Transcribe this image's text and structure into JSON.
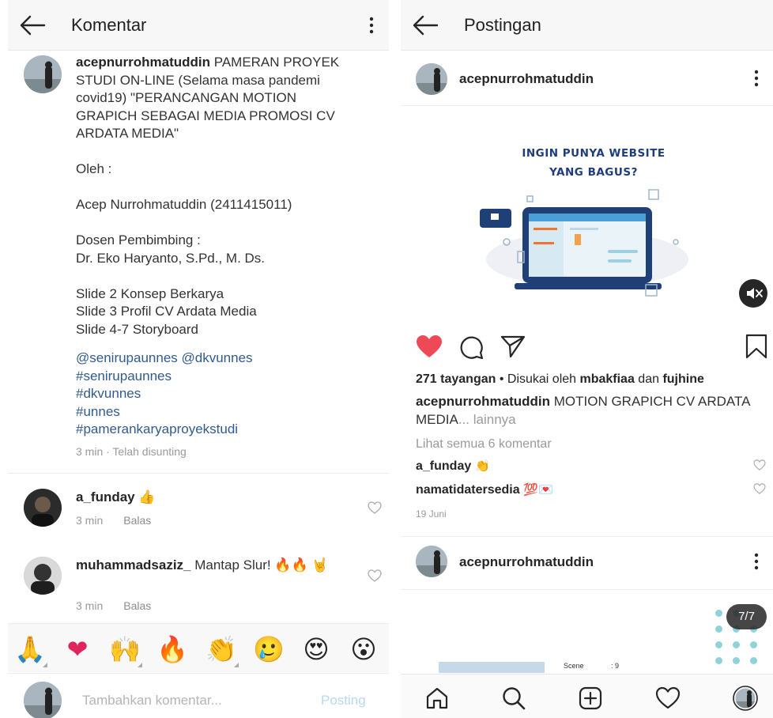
{
  "comments_screen": {
    "title": "Komentar",
    "caption": {
      "username": "acepnurrohmatuddin",
      "text": " PAMERAN PROYEK STUDI ON-LINE (Selama masa pandemi covid19) \"PERANCANGAN MOTION GRAPICH SEBAGAI MEDIA PROMOSI CV ARDATA MEDIA\"\n\nOleh :\n\nAcep Nurrohmatuddin (2411415011)\n\nDosen Pembimbing :\nDr. Eko Haryanto, S.Pd., M. Ds.\n\nSlide 2 Konsep Berkarya\nSlide 3 Profil CV Ardata Media\nSlide 4-7 Storyboard",
      "tags": "@senirupaunnes @dkvunnes\n#senirupaunnes\n#dkvunnes\n#unnes\n#pamerankaryaproyekstudi",
      "meta": "3 min · Telah disunting"
    },
    "comments": [
      {
        "username": "a_funday",
        "text": " 👍",
        "time": "3 min",
        "reply": "Balas"
      },
      {
        "username": "muhammadsaziz_",
        "text": " Mantap Slur! 🔥🔥 🤘",
        "time": "3 min",
        "reply": "Balas"
      }
    ],
    "emoji_bar": [
      "🙏",
      "❤",
      "🙌",
      "🔥",
      "👏",
      "🥲",
      "😍",
      "😮"
    ],
    "compose": {
      "placeholder": "Tambahkan komentar...",
      "post_label": "Posting"
    }
  },
  "post_screen": {
    "title": "Postingan",
    "post": {
      "username": "acepnurrohmatuddin",
      "image_headline": "INGIN PUNYA WEBSITE\nYANG BAGUS?",
      "views": "271 tayangan",
      "liked_by_prefix": " • Disukai oleh ",
      "liker1": "mbakfiaa",
      "liked_by_join": " dan ",
      "liker2": "fujhine",
      "caption_username": "acepnurrohmatuddin",
      "caption_text": " MOTION GRAPICH CV ARDATA MEDIA",
      "more": "... lainnya",
      "view_all": "Lihat semua 6 komentar",
      "comments": [
        {
          "username": "a_funday",
          "emoji": " 👏"
        },
        {
          "username": "namatidatersedia",
          "emoji": " 💯💌"
        }
      ],
      "date": "19 Juni"
    },
    "post2": {
      "username": "acepnurrohmatuddin",
      "counter": "7/7",
      "scene_label": "Scene",
      "scene_value": ": 9"
    },
    "colors": {
      "like_red": "#ed4956",
      "link_blue": "#315b8e",
      "post_btn_disabled": "#b8d7f5"
    }
  }
}
